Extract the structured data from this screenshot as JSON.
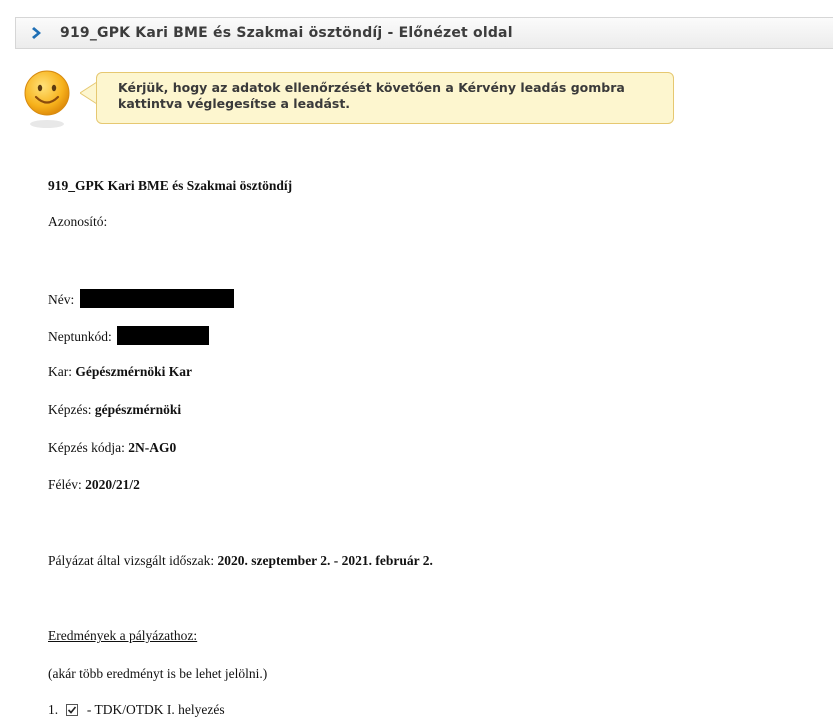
{
  "header": {
    "title": "919_GPK Kari BME és Szakmai ösztöndíj - Előnézet oldal"
  },
  "notice": {
    "line1": "Kérjük, hogy az adatok ellenőrzését követően a Kérvény leadás gombra",
    "line2": "kattintva véglegesítse a leadást."
  },
  "form": {
    "title": "919_GPK Kari BME és Szakmai ösztöndíj",
    "id_label": "Azonosító:",
    "name_label": "Név:",
    "neptun_label": "Neptunkód:",
    "faculty_label": "Kar:",
    "faculty_value": "Gépészmérnöki Kar",
    "program_label": "Képzés:",
    "program_value": "gépészmérnöki",
    "program_code_label": "Képzés kódja:",
    "program_code_value": "2N-AG0",
    "semester_label": "Félév:",
    "semester_value": "2020/21/2",
    "period_label": "Pályázat által vizsgált időszak:",
    "period_value": "2020. szeptember 2. - 2021. február 2.",
    "results_heading": "Eredmények a pályázathoz:",
    "results_note": "(akár több eredményt is be lehet jelölni.)",
    "item1_number": "1.",
    "item1_label": "- TDK/OTDK I. helyezés",
    "item1_checked": true
  }
}
